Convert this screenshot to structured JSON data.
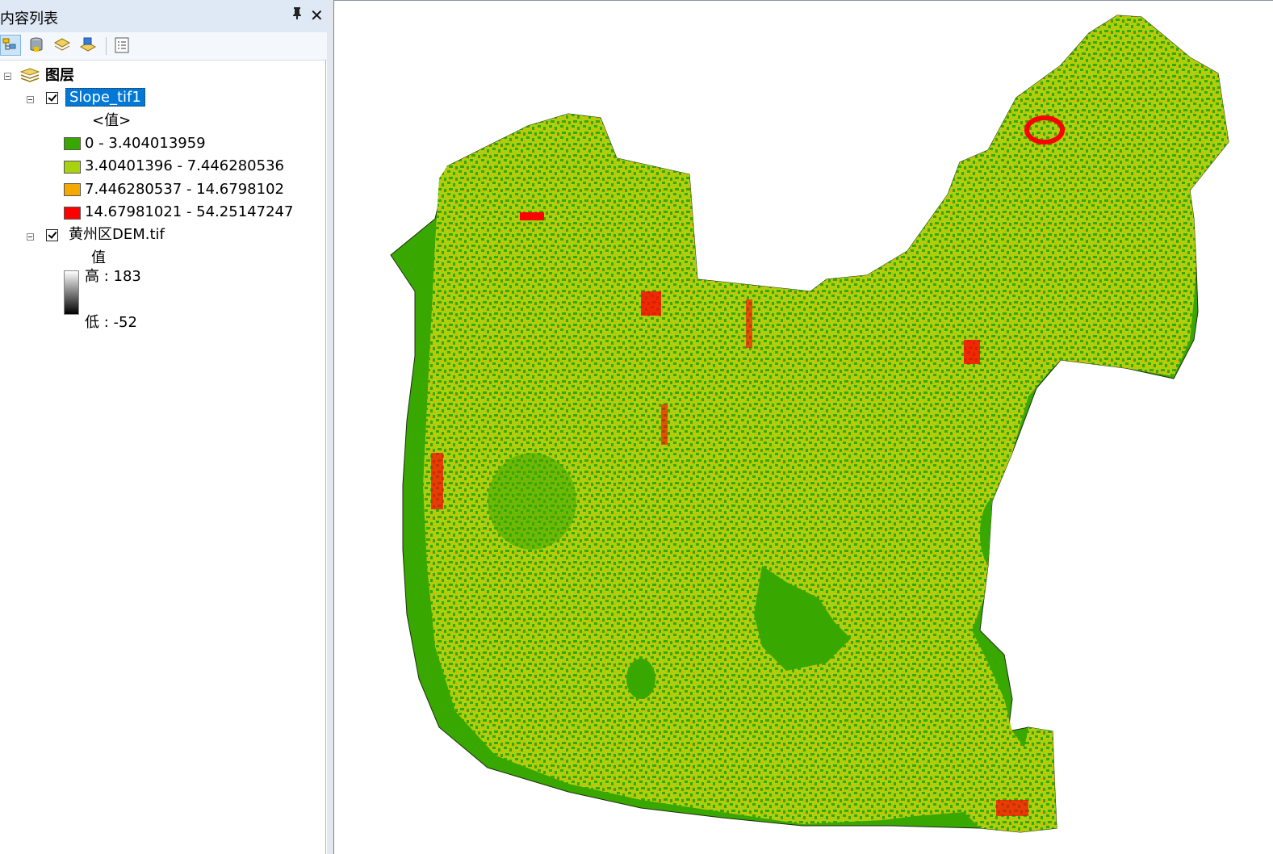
{
  "toc": {
    "title": "内容列表",
    "pin_glyph": "ㅁ",
    "close_glyph": "✕",
    "toolbar": [
      "list-by-drawing-order-icon",
      "list-by-source-icon",
      "list-by-visibility-icon",
      "list-by-selection-icon",
      "options-icon"
    ],
    "root_layer": "图层",
    "layers": [
      {
        "name": "Slope_tif1",
        "checked": true,
        "selected": true,
        "field": "<值>",
        "classes": [
          {
            "label": "0 - 3.404013959",
            "color": "#38a800"
          },
          {
            "label": "3.40401396 - 7.446280536",
            "color": "#a8d10f"
          },
          {
            "label": "7.446280537 - 14.6798102",
            "color": "#f5a800"
          },
          {
            "label": "14.67981021 - 54.25147247",
            "color": "#ff0000"
          }
        ]
      },
      {
        "name": "黄州区DEM.tif",
        "checked": true,
        "selected": false,
        "field": "值",
        "high": "高 : 183",
        "low": "低 : -52"
      }
    ]
  },
  "map": {
    "background": "#ffffff",
    "palette": [
      "#38a800",
      "#a8d10f",
      "#f5a800",
      "#ff0000"
    ]
  }
}
